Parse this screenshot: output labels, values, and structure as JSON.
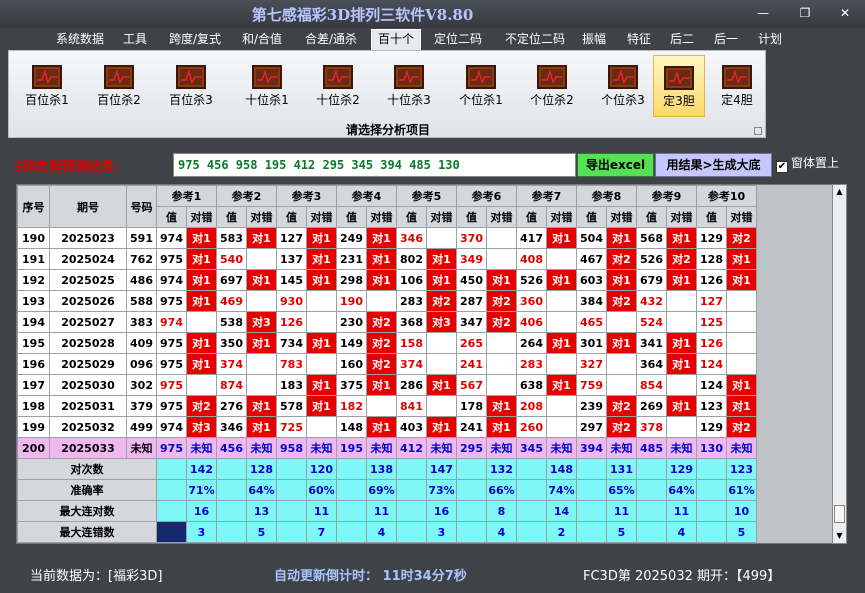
{
  "window": {
    "title": "第七感福彩3D排列三软件V8.80",
    "min": "—",
    "restore": "❐",
    "close": "✕"
  },
  "menu": [
    "系统数据",
    "工具",
    "跨度/复式",
    "和/合值",
    "合差/通杀",
    "百十个",
    "定位二码",
    "不定位二码",
    "振幅",
    "特征",
    "后二",
    "后一",
    "计划"
  ],
  "menu_active": "百十个",
  "toolbar": {
    "items": [
      "百位杀1",
      "百位杀2",
      "百位杀3",
      "十位杀1",
      "十位杀2",
      "十位杀3",
      "个位杀1",
      "个位杀2",
      "个位杀3",
      "定3胆",
      "定4胆"
    ],
    "selected": "定3胆",
    "caption": "请选择分析项目"
  },
  "prediction": {
    "label": "3码定胆预测结果：",
    "value": "975 456 958 195 412 295 345 394 485 130",
    "excel_button": "导出excel",
    "gen_button": "用结果>生成大底",
    "topmost_label": "窗体置上",
    "topmost_checked": true
  },
  "table": {
    "headers": {
      "seq": "序号",
      "period": "期号",
      "number": "号码",
      "val": "值",
      "hit": "对错"
    },
    "refs": [
      "参考1",
      "参考2",
      "参考3",
      "参考4",
      "参考5",
      "参考6",
      "参考7",
      "参考8",
      "参考9",
      "参考10"
    ],
    "rows": [
      {
        "seq": "190",
        "period": "2025023",
        "num": "591",
        "cells": [
          [
            "974",
            "对1"
          ],
          [
            "583",
            "对1"
          ],
          [
            "127",
            "对1"
          ],
          [
            "249",
            "对1"
          ],
          [
            "346",
            ""
          ],
          [
            "370",
            ""
          ],
          [
            "417",
            "对1"
          ],
          [
            "504",
            "对1"
          ],
          [
            "568",
            "对1"
          ],
          [
            "129",
            "对2"
          ]
        ]
      },
      {
        "seq": "191",
        "period": "2025024",
        "num": "762",
        "cells": [
          [
            "975",
            "对1"
          ],
          [
            "540",
            ""
          ],
          [
            "137",
            "对1"
          ],
          [
            "231",
            "对1"
          ],
          [
            "802",
            "对1"
          ],
          [
            "349",
            ""
          ],
          [
            "408",
            ""
          ],
          [
            "467",
            "对2"
          ],
          [
            "526",
            "对2"
          ],
          [
            "128",
            "对1"
          ]
        ]
      },
      {
        "seq": "192",
        "period": "2025025",
        "num": "486",
        "cells": [
          [
            "974",
            "对1"
          ],
          [
            "697",
            "对1"
          ],
          [
            "145",
            "对1"
          ],
          [
            "298",
            "对1"
          ],
          [
            "106",
            "对1"
          ],
          [
            "450",
            "对1"
          ],
          [
            "526",
            "对1"
          ],
          [
            "603",
            "对1"
          ],
          [
            "679",
            "对1"
          ],
          [
            "126",
            "对1"
          ]
        ]
      },
      {
        "seq": "193",
        "period": "2025026",
        "num": "588",
        "cells": [
          [
            "975",
            "对1"
          ],
          [
            "469",
            ""
          ],
          [
            "930",
            ""
          ],
          [
            "190",
            ""
          ],
          [
            "283",
            "对2"
          ],
          [
            "287",
            "对2"
          ],
          [
            "360",
            ""
          ],
          [
            "384",
            "对2"
          ],
          [
            "432",
            ""
          ],
          [
            "127",
            ""
          ]
        ]
      },
      {
        "seq": "194",
        "period": "2025027",
        "num": "383",
        "cells": [
          [
            "974",
            ""
          ],
          [
            "538",
            "对3"
          ],
          [
            "126",
            ""
          ],
          [
            "230",
            "对2"
          ],
          [
            "368",
            "对3"
          ],
          [
            "347",
            "对2"
          ],
          [
            "406",
            ""
          ],
          [
            "465",
            ""
          ],
          [
            "524",
            ""
          ],
          [
            "125",
            ""
          ]
        ]
      },
      {
        "seq": "195",
        "period": "2025028",
        "num": "409",
        "cells": [
          [
            "975",
            "对1"
          ],
          [
            "350",
            "对1"
          ],
          [
            "734",
            "对1"
          ],
          [
            "149",
            "对2"
          ],
          [
            "158",
            ""
          ],
          [
            "265",
            ""
          ],
          [
            "264",
            "对1"
          ],
          [
            "301",
            "对1"
          ],
          [
            "341",
            "对1"
          ],
          [
            "126",
            ""
          ]
        ]
      },
      {
        "seq": "196",
        "period": "2025029",
        "num": "096",
        "cells": [
          [
            "975",
            "对1"
          ],
          [
            "374",
            ""
          ],
          [
            "783",
            ""
          ],
          [
            "160",
            "对2"
          ],
          [
            "374",
            ""
          ],
          [
            "241",
            ""
          ],
          [
            "283",
            ""
          ],
          [
            "327",
            ""
          ],
          [
            "364",
            "对1"
          ],
          [
            "124",
            ""
          ]
        ]
      },
      {
        "seq": "197",
        "period": "2025030",
        "num": "302",
        "cells": [
          [
            "975",
            ""
          ],
          [
            "874",
            ""
          ],
          [
            "183",
            "对1"
          ],
          [
            "375",
            "对1"
          ],
          [
            "286",
            "对1"
          ],
          [
            "567",
            ""
          ],
          [
            "638",
            "对1"
          ],
          [
            "759",
            ""
          ],
          [
            "854",
            ""
          ],
          [
            "124",
            "对1"
          ]
        ]
      },
      {
        "seq": "198",
        "period": "2025031",
        "num": "379",
        "cells": [
          [
            "975",
            "对2"
          ],
          [
            "276",
            "对1"
          ],
          [
            "578",
            "对1"
          ],
          [
            "182",
            ""
          ],
          [
            "841",
            ""
          ],
          [
            "178",
            "对1"
          ],
          [
            "208",
            ""
          ],
          [
            "239",
            "对2"
          ],
          [
            "269",
            "对1"
          ],
          [
            "123",
            "对1"
          ]
        ]
      },
      {
        "seq": "199",
        "period": "2025032",
        "num": "499",
        "cells": [
          [
            "974",
            "对3"
          ],
          [
            "346",
            "对1"
          ],
          [
            "725",
            ""
          ],
          [
            "148",
            "对1"
          ],
          [
            "403",
            "对1"
          ],
          [
            "241",
            "对1"
          ],
          [
            "260",
            ""
          ],
          [
            "297",
            "对2"
          ],
          [
            "378",
            ""
          ],
          [
            "129",
            "对2"
          ]
        ]
      }
    ],
    "predict_row": {
      "seq": "200",
      "period": "2025033",
      "num": "未知",
      "cells": [
        [
          "975",
          "未知"
        ],
        [
          "456",
          "未知"
        ],
        [
          "958",
          "未知"
        ],
        [
          "195",
          "未知"
        ],
        [
          "412",
          "未知"
        ],
        [
          "295",
          "未知"
        ],
        [
          "345",
          "未知"
        ],
        [
          "394",
          "未知"
        ],
        [
          "485",
          "未知"
        ],
        [
          "130",
          "未知"
        ]
      ]
    },
    "stats": [
      {
        "label": "对次数",
        "values": [
          "142",
          "128",
          "120",
          "138",
          "147",
          "132",
          "148",
          "131",
          "129",
          "123"
        ]
      },
      {
        "label": "准确率",
        "values": [
          "71%",
          "64%",
          "60%",
          "69%",
          "73%",
          "66%",
          "74%",
          "65%",
          "64%",
          "61%"
        ]
      },
      {
        "label": "最大连对数",
        "values": [
          "16",
          "13",
          "11",
          "11",
          "16",
          "8",
          "14",
          "11",
          "11",
          "10"
        ]
      },
      {
        "label": "最大连错数",
        "values": [
          "3",
          "5",
          "7",
          "4",
          "3",
          "4",
          "2",
          "5",
          "4",
          "5"
        ]
      }
    ]
  },
  "status": {
    "current": "当前数据为：[福彩3D]",
    "countdown": "自动更新倒计时：  11时34分7秒",
    "issue": "FC3D第 2025032 期开：【499】"
  }
}
